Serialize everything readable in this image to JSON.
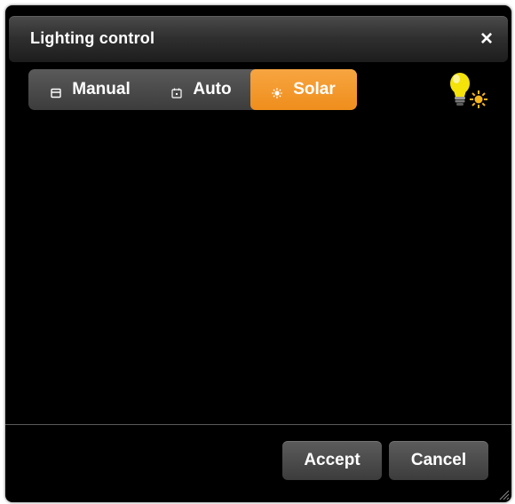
{
  "dialog": {
    "title": "Lighting control",
    "close_label": "×"
  },
  "modes": [
    {
      "label": "Manual",
      "icon": "manual-icon",
      "selected": false
    },
    {
      "label": "Auto",
      "icon": "auto-icon",
      "selected": false
    },
    {
      "label": "Solar",
      "icon": "sun-icon",
      "selected": true
    }
  ],
  "status_icon": "lightbulb-sun-icon",
  "footer": {
    "accept_label": "Accept",
    "cancel_label": "Cancel"
  },
  "colors": {
    "accent": "#F39A2C",
    "background": "#000000",
    "titlebar": "#333333",
    "bulb": "#F4E20A"
  }
}
